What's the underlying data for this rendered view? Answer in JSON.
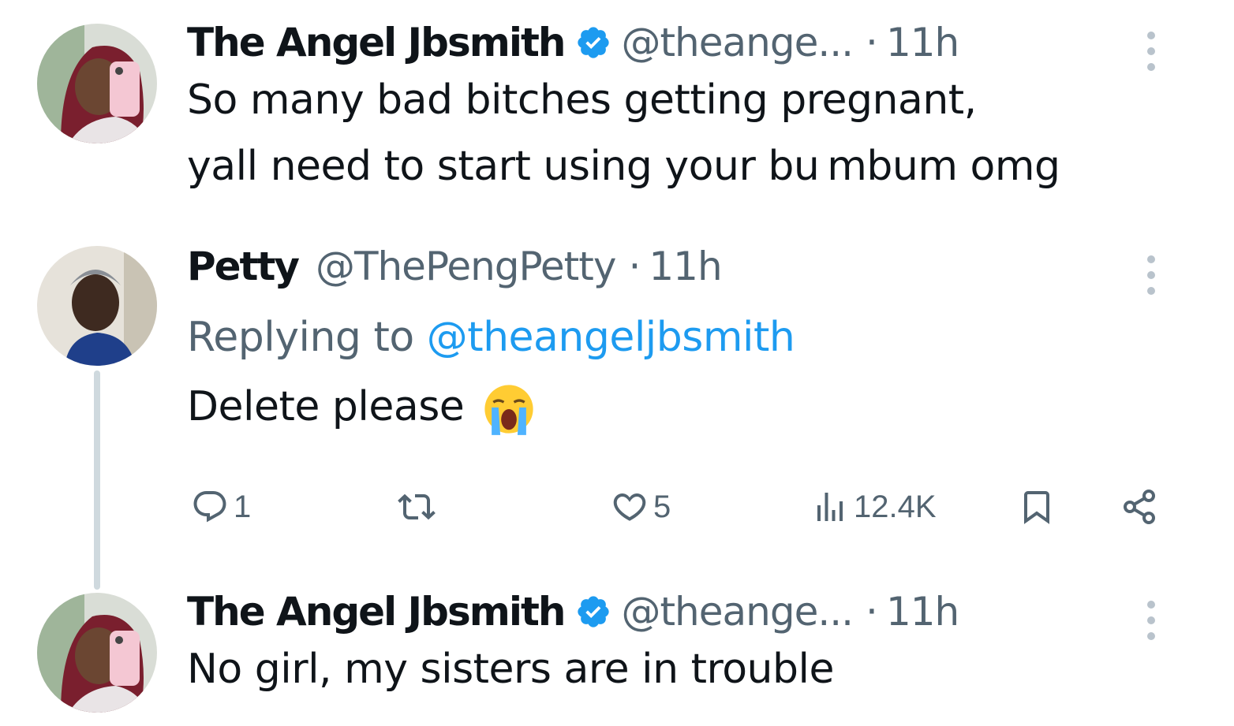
{
  "tweets": [
    {
      "name": "The Angel Jbsmith",
      "verified": true,
      "handle": "@theange...",
      "time": "11h",
      "text_lines": [
        "So many bad bitches getting pregnant,",
        "yall need to start using your bu mbum omg"
      ]
    },
    {
      "name": "Petty",
      "verified": false,
      "handle": "@ThePengPetty",
      "time": "11h",
      "reply_prefix": "Replying to",
      "reply_mention": "@theangeljbsmith",
      "text": "Delete please",
      "emoji": "loudly-crying-face",
      "actions": {
        "replies": "1",
        "reposts": "",
        "likes": "5",
        "views": "12.4K"
      }
    },
    {
      "name": "The Angel Jbsmith",
      "verified": true,
      "handle": "@theange...",
      "time": "11h",
      "text": "No girl, my sisters are in trouble"
    }
  ],
  "colors": {
    "text": "#0f1419",
    "secondary": "#536471",
    "link": "#1d9bf0",
    "verified": "#1d9bf0",
    "thread_line": "#cfd9de"
  }
}
